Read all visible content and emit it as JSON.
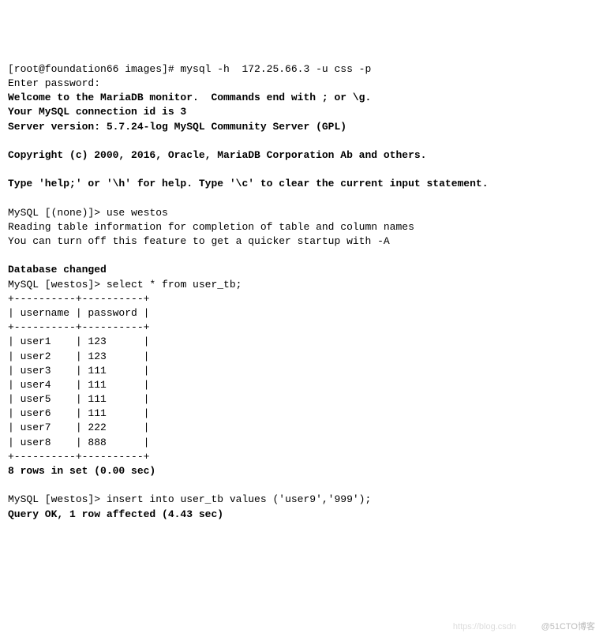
{
  "prompt_line": "[root@foundation66 images]# mysql -h  172.25.66.3 -u css -p",
  "enter_password": "Enter password:",
  "welcome": "Welcome to the MariaDB monitor.  Commands end with ; or \\g.",
  "connection_id": "Your MySQL connection id is 3",
  "server_version": "Server version: 5.7.24-log MySQL Community Server (GPL)",
  "copyright": "Copyright (c) 2000, 2016, Oracle, MariaDB Corporation Ab and others.",
  "help_line": "Type 'help;' or '\\h' for help. Type '\\c' to clear the current input statement.",
  "prompt_none": "MySQL [(none)]> ",
  "cmd_use": "use westos",
  "reading": "Reading table information for completion of table and column names",
  "turnoff": "You can turn off this feature to get a quicker startup with -A",
  "db_changed": "Database changed",
  "prompt_westos": "MySQL [westos]> ",
  "cmd_select": "select * from user_tb;",
  "table_border": "+----------+----------+",
  "table_header": "| username | password |",
  "table_rows": [
    "| user1    | 123      |",
    "| user2    | 123      |",
    "| user3    | 111      |",
    "| user4    | 111      |",
    "| user5    | 111      |",
    "| user6    | 111      |",
    "| user7    | 222      |",
    "| user8    | 888      |"
  ],
  "rows_in_set": "8 rows in set (0.00 sec)",
  "cmd_insert": "insert into user_tb values ('user9','999');",
  "query_ok": "Query OK, 1 row affected (4.43 sec)",
  "watermark1": "https://blog.csdn",
  "watermark2": "@51CTO博客",
  "chart_data": {
    "type": "table",
    "columns": [
      "username",
      "password"
    ],
    "rows": [
      [
        "user1",
        "123"
      ],
      [
        "user2",
        "123"
      ],
      [
        "user3",
        "111"
      ],
      [
        "user4",
        "111"
      ],
      [
        "user5",
        "111"
      ],
      [
        "user6",
        "111"
      ],
      [
        "user7",
        "222"
      ],
      [
        "user8",
        "888"
      ]
    ]
  }
}
